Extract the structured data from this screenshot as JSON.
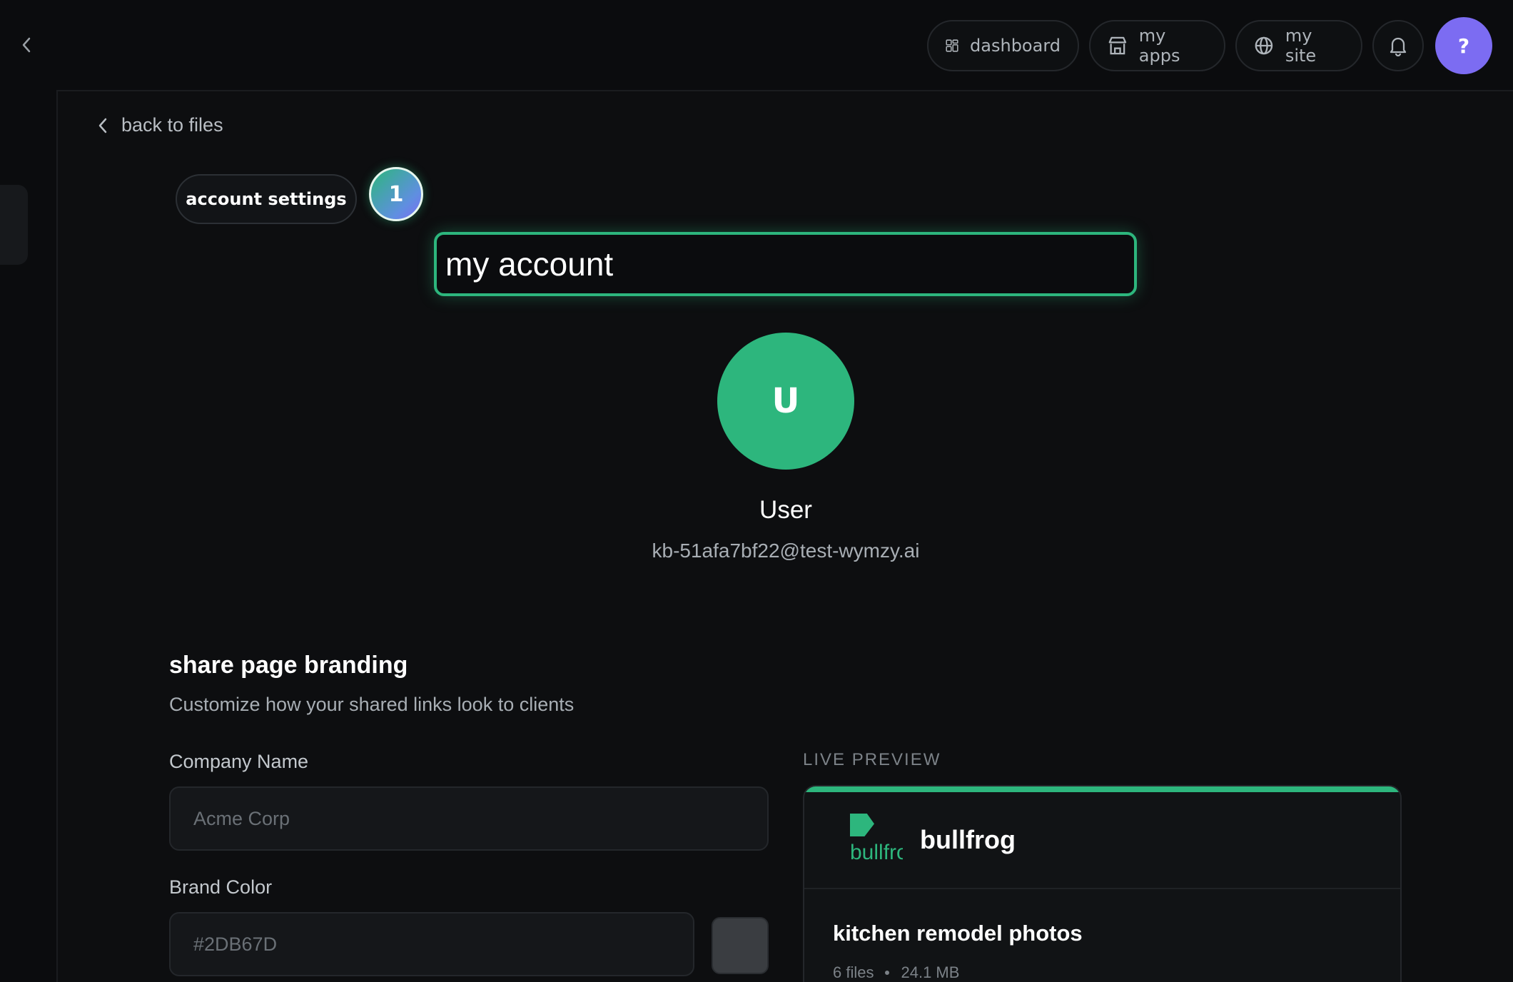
{
  "topnav": {
    "items": [
      {
        "label": "dashboard",
        "icon": "grid-icon"
      },
      {
        "label": "my apps",
        "icon": "store-icon"
      },
      {
        "label": "my site",
        "icon": "globe-icon"
      }
    ],
    "help_label": "?",
    "help_color": "#7c6cf2"
  },
  "page": {
    "back_label": "back to files",
    "tab_label": "account settings",
    "step_number": "1",
    "title_value": "my account"
  },
  "profile": {
    "avatar_initial": "U",
    "avatar_color": "#2db67d",
    "name": "User",
    "email": "kb-51afa7bf22@test-wymzy.ai"
  },
  "branding": {
    "title": "share page branding",
    "subtitle": "Customize how your shared links look to clients",
    "company_label": "Company Name",
    "company_placeholder": "Acme Corp",
    "color_label": "Brand Color",
    "color_placeholder": "#2DB67D"
  },
  "preview": {
    "label": "LIVE PREVIEW",
    "logo_text": "bullfrog",
    "brand_name": "bullfrog",
    "file_title": "kitchen remodel photos",
    "file_count": "6 files",
    "file_size": "24.1 MB",
    "accent": "#2db67d"
  }
}
